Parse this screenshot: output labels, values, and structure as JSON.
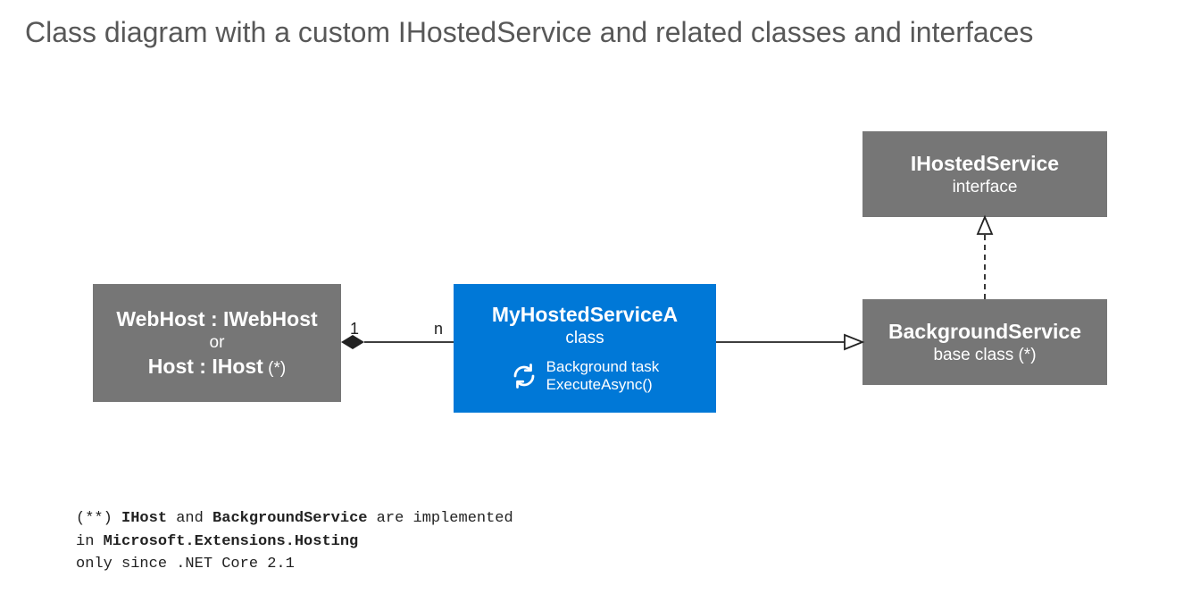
{
  "title": "Class diagram with a custom IHostedService and related classes and interfaces",
  "webhost": {
    "line1_a": "WebHost : IWebHost",
    "line2": "or",
    "line3_a": "Host : IHost",
    "line3_b": " (*)"
  },
  "myservice": {
    "name": "MyHostedServiceA",
    "stereo": "class",
    "task_line1": "Background task",
    "task_line2": "ExecuteAsync()"
  },
  "bgservice": {
    "name": "BackgroundService",
    "stereo": "base class (*)"
  },
  "ihostedservice": {
    "name": "IHostedService",
    "stereo": "interface"
  },
  "mult": {
    "one": "1",
    "n": "n"
  },
  "footnote": {
    "prefix": "(**) ",
    "b1": "IHost",
    "mid1": " and ",
    "b2": "BackgroundService",
    "mid2": " are implemented",
    "line2a": "in ",
    "b3": "Microsoft.Extensions.Hosting",
    "line3": "only since .NET Core 2.1"
  }
}
